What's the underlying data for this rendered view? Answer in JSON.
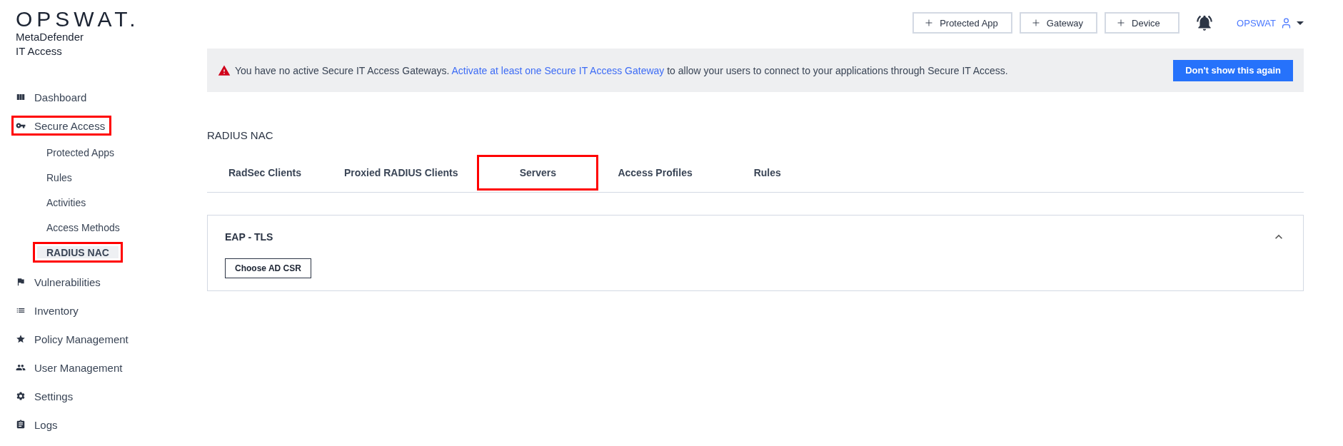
{
  "brand": {
    "logo": "OPSWAT.",
    "product_line_1": "MetaDefender",
    "product_line_2": "IT Access"
  },
  "sidebar": {
    "items": [
      {
        "label": "Dashboard",
        "highlighted": false
      },
      {
        "label": "Secure Access",
        "highlighted": true,
        "children": [
          {
            "label": "Protected Apps",
            "selected": false,
            "highlighted": false
          },
          {
            "label": "Rules",
            "selected": false,
            "highlighted": false
          },
          {
            "label": "Activities",
            "selected": false,
            "highlighted": false
          },
          {
            "label": "Access Methods",
            "selected": false,
            "highlighted": false
          },
          {
            "label": "RADIUS NAC",
            "selected": true,
            "highlighted": true
          }
        ]
      },
      {
        "label": "Vulnerabilities",
        "highlighted": false
      },
      {
        "label": "Inventory",
        "highlighted": false
      },
      {
        "label": "Policy Management",
        "highlighted": false
      },
      {
        "label": "User Management",
        "highlighted": false
      },
      {
        "label": "Settings",
        "highlighted": false
      },
      {
        "label": "Logs",
        "highlighted": false
      }
    ]
  },
  "header": {
    "buttons": [
      "Protected App",
      "Gateway",
      "Device"
    ],
    "user": "OPSWAT"
  },
  "banner": {
    "text_before": "You have no active Secure IT Access Gateways.",
    "link": "Activate at least one Secure IT Access Gateway",
    "text_after": "to allow your users to connect to your applications through Secure IT Access.",
    "button": "Don't show this again"
  },
  "page_title": "RADIUS NAC",
  "tabs": [
    {
      "label": "RadSec Clients",
      "highlighted": false
    },
    {
      "label": "Proxied RADIUS Clients",
      "highlighted": false
    },
    {
      "label": "Servers",
      "highlighted": true
    },
    {
      "label": "Access Profiles",
      "highlighted": false
    },
    {
      "label": "Rules",
      "highlighted": false
    }
  ],
  "panel": {
    "title": "EAP - TLS",
    "expanded": true,
    "button": "Choose AD CSR"
  }
}
